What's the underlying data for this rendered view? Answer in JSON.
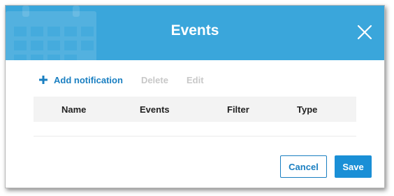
{
  "dialog": {
    "title": "Events",
    "close_icon": "close-icon",
    "header_decoration_icon": "calendar-icon",
    "colors": {
      "header": "#3aa6db",
      "accent": "#1a7fc1",
      "save_button": "#1a8fd6",
      "disabled_text": "#c8c8c8"
    }
  },
  "toolbar": {
    "add_icon": "plus-icon",
    "add_label": "Add notification",
    "delete_label": "Delete",
    "edit_label": "Edit"
  },
  "table": {
    "columns": [
      "Name",
      "Events",
      "Filter",
      "Type"
    ],
    "rows": []
  },
  "footer": {
    "cancel_label": "Cancel",
    "save_label": "Save"
  }
}
